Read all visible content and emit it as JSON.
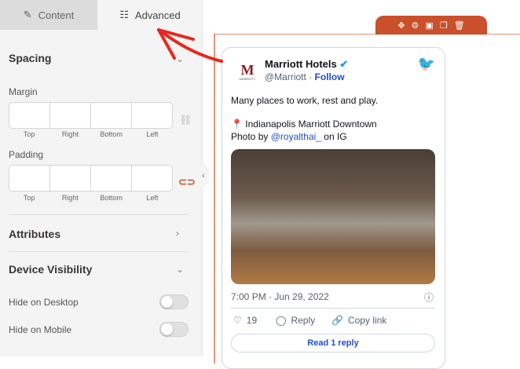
{
  "tabs": {
    "content": "Content",
    "advanced": "Advanced"
  },
  "spacing": {
    "title": "Spacing",
    "margin": "Margin",
    "padding": "Padding",
    "sides": [
      "Top",
      "Right",
      "Bottom",
      "Left"
    ]
  },
  "attributes": "Attributes",
  "device_visibility": {
    "title": "Device Visibility",
    "hide_desktop": "Hide on Desktop",
    "hide_mobile": "Hide on Mobile"
  },
  "colors": {
    "accent": "#c9502a",
    "twitter": "#1d9bf0"
  },
  "tweet": {
    "name": "Marriott Hotels",
    "handle": "@Marriott",
    "follow": "Follow",
    "line1": "Many places to work, rest and play.",
    "pin": "📍",
    "location": "Indianapolis Marriott Downtown",
    "photo_by": "Photo by",
    "photo_user": "@royalthai_",
    "on_ig": "on IG",
    "time": "7:00 PM · Jun 29, 2022",
    "likes": "19",
    "reply": "Reply",
    "copy": "Copy link",
    "read": "Read 1 reply",
    "logo_text": "MARRIOTT"
  }
}
